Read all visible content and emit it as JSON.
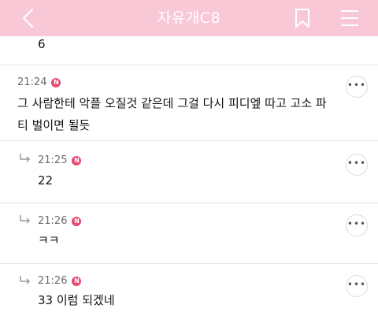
{
  "header": {
    "title": "자유개C8",
    "back_icon": "chevron-left-icon",
    "bookmark_icon": "bookmark-icon",
    "menu_icon": "hamburger-menu-icon",
    "background_color": "#f9c8d6"
  },
  "previous_comment_tail": "6",
  "comments": [
    {
      "time": "21:24",
      "badge": "N",
      "text_line1": "그 사람한테 악플 오질것 같은데 그걸 다시 피디엪 따고 고소 파",
      "text_line2": "티 벌이면 될듯",
      "is_reply": false
    },
    {
      "time": "21:25",
      "badge": "N",
      "text": "22",
      "is_reply": true
    },
    {
      "time": "21:26",
      "badge": "N",
      "text": "ㅋㅋ",
      "is_reply": true
    },
    {
      "time": "21:26",
      "badge": "N",
      "text": "33 이럼 되겠네",
      "is_reply": true
    }
  ],
  "more_button_label": "•••",
  "badge_color": "#e34a6f"
}
